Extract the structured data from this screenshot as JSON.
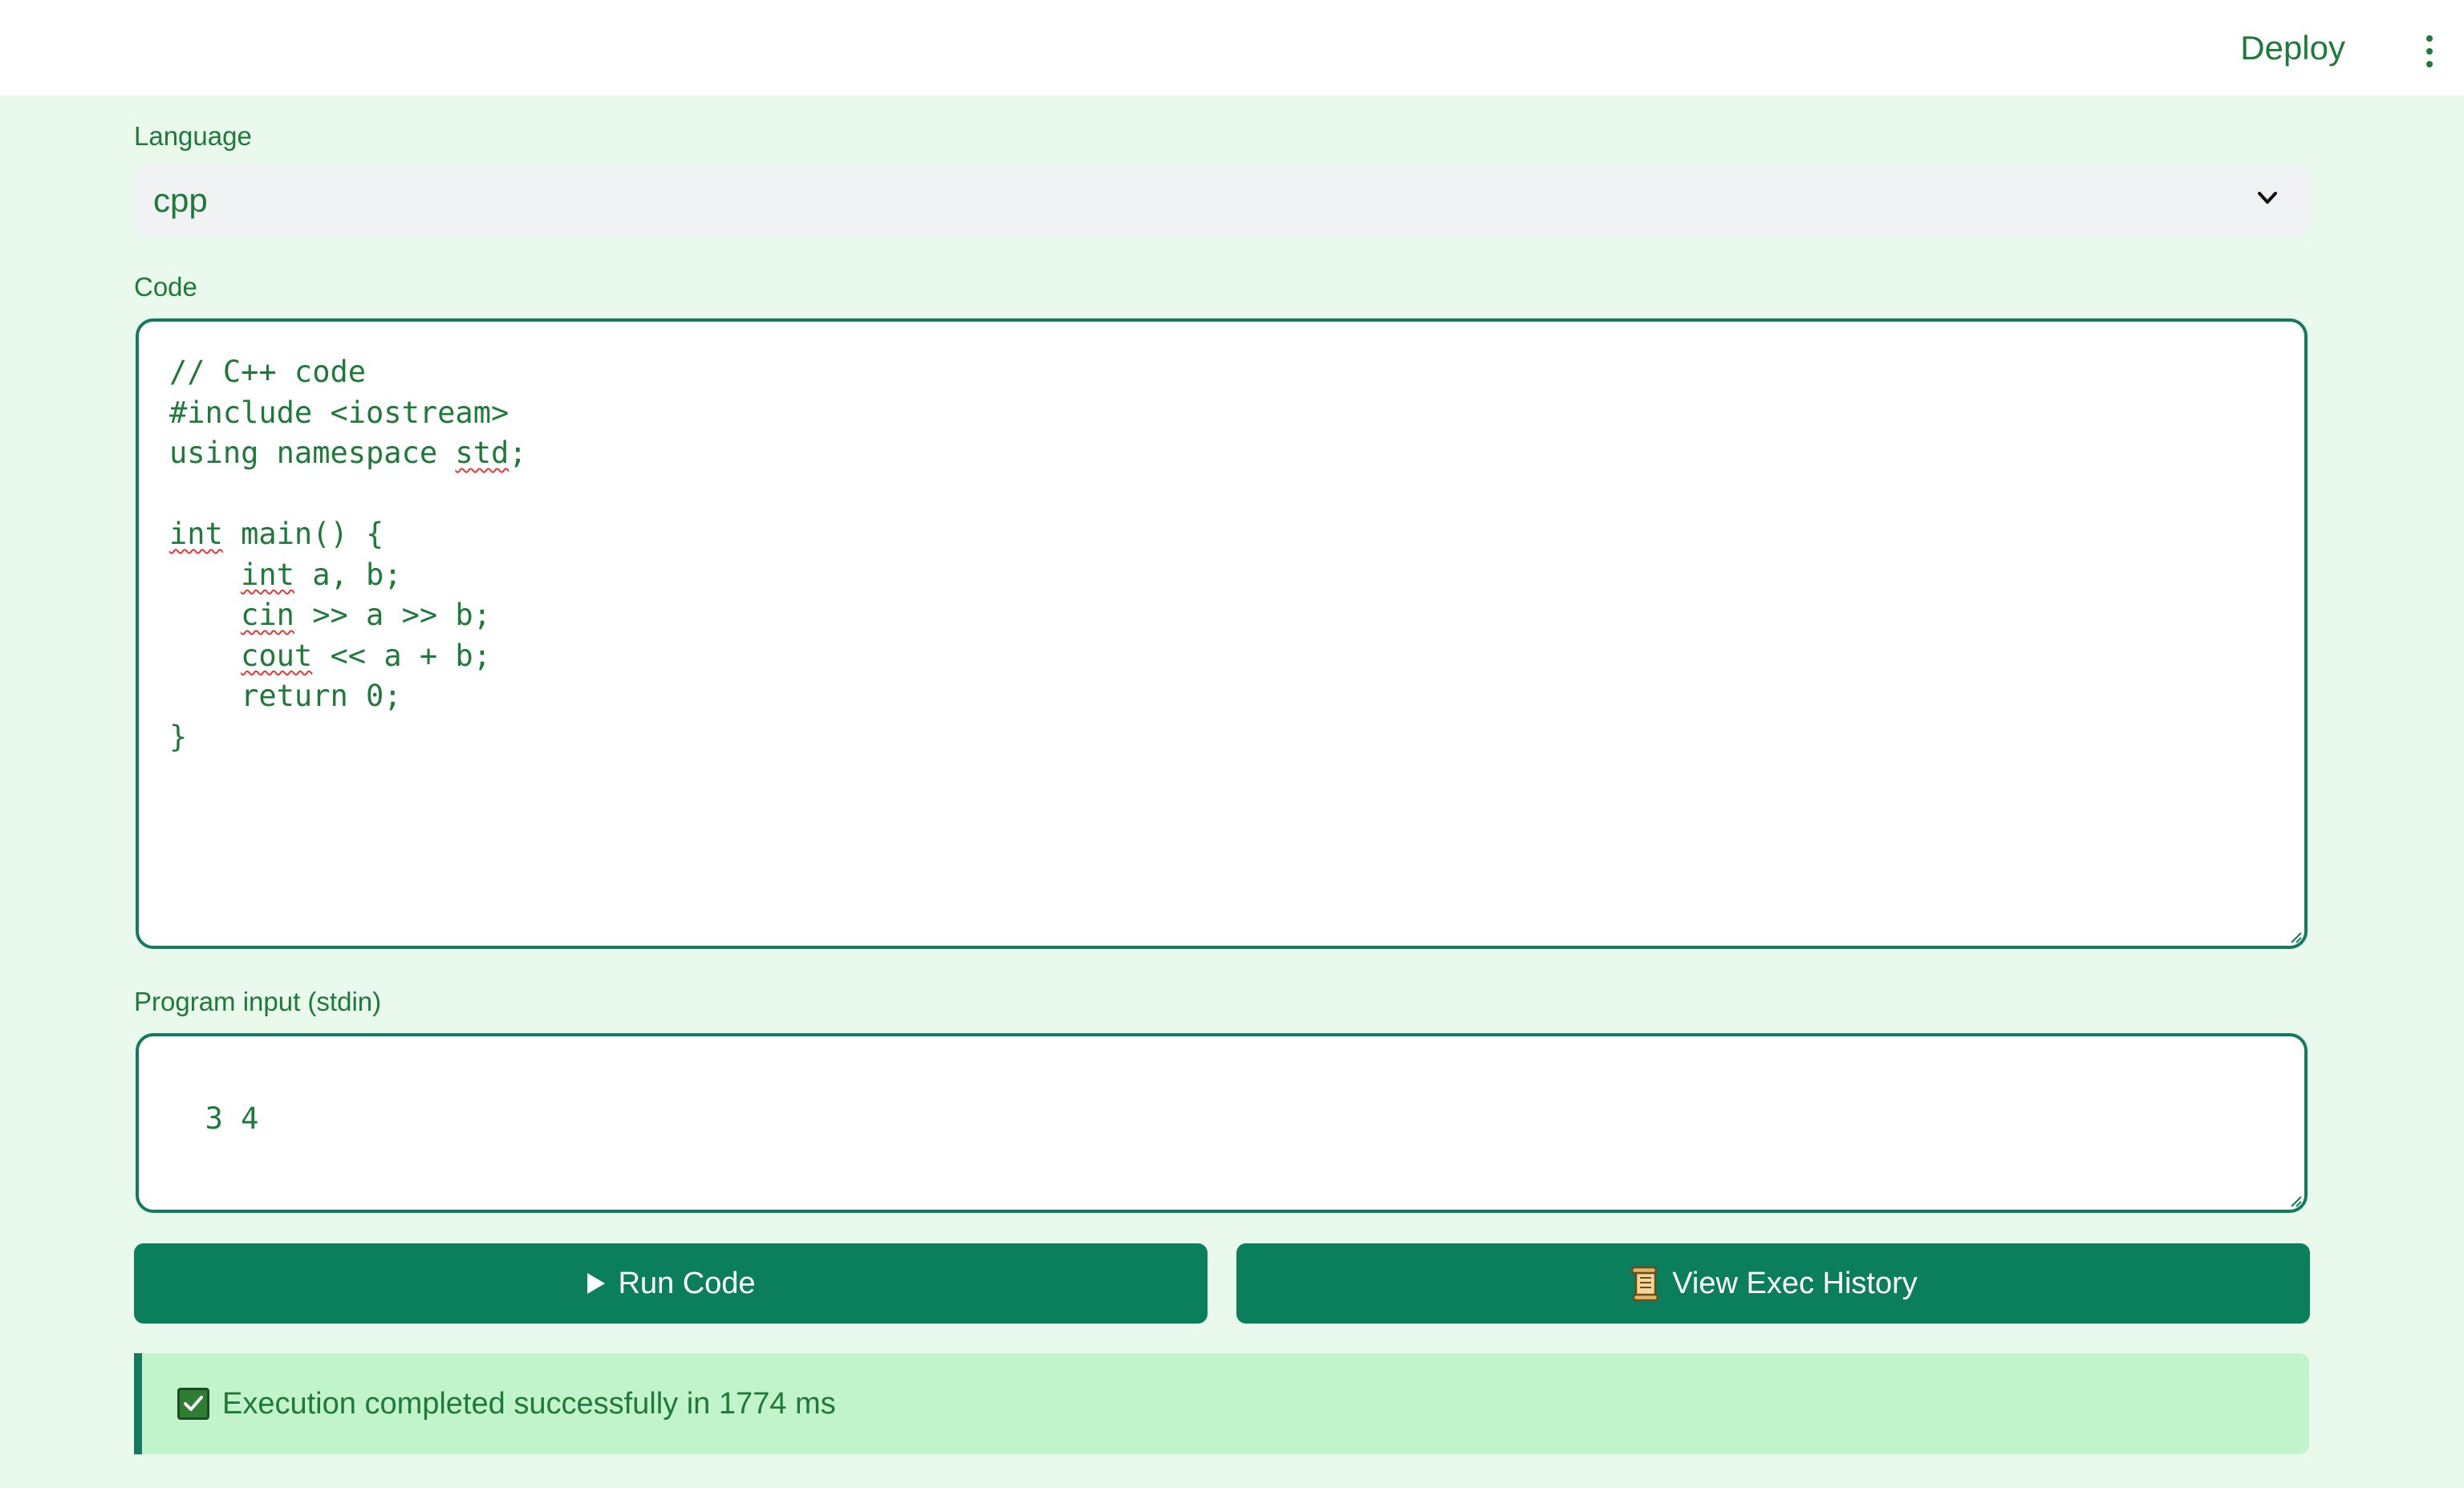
{
  "header": {
    "deploy_label": "Deploy",
    "menu_icon": "kebab-menu-icon"
  },
  "language": {
    "label": "Language",
    "selected": "cpp",
    "icon": "chevron-down-icon"
  },
  "code": {
    "label": "Code",
    "lines": [
      "// C++ code",
      "#include <iostream>",
      "using namespace std;",
      "",
      "int main() {",
      "    int a, b;",
      "    cin >> a >> b;",
      "    cout << a + b;",
      "    return 0;",
      "}"
    ],
    "spellcheck_flagged": [
      "std",
      "int",
      "cin",
      "cout"
    ]
  },
  "stdin": {
    "label": "Program input (stdin)",
    "value": "3 4"
  },
  "actions": {
    "run_label": "Run Code",
    "run_icon": "play-icon",
    "history_label": "View Exec History",
    "history_icon": "scroll-icon"
  },
  "status": {
    "icon": "check-box-icon",
    "message": "Execution completed successfully in 1774 ms"
  },
  "colors": {
    "accent": "#0b7e5c",
    "text": "#1f7a3a",
    "page_bg": "#e9f9ec",
    "success_bg": "#c2f4cc",
    "spellcheck": "#e53935"
  }
}
